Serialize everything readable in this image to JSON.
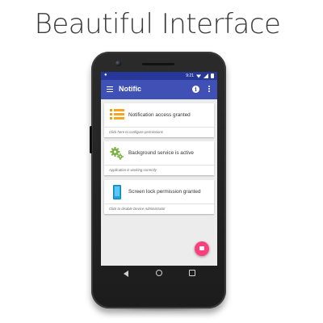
{
  "headline": "Beautiful Interface",
  "status_bar": {
    "time": "9:21",
    "notif_icon": "notification-icon"
  },
  "app_bar": {
    "title": "Notific",
    "menu_icon": "menu-icon",
    "info_icon": "info-icon",
    "overflow_icon": "overflow-menu-icon",
    "info_glyph": "i"
  },
  "cards": [
    {
      "title": "Notification access granted",
      "subtitle": "Click here to configure permissions",
      "icon": "list-icon"
    },
    {
      "title": "Background service is active",
      "subtitle": "Application is working correctly",
      "icon": "gears-icon"
    },
    {
      "title": "Screen lock permission granted",
      "subtitle": "Click to disable Device Administrator",
      "icon": "phone-icon"
    }
  ],
  "fab": {
    "icon": "feedback-icon"
  },
  "nav_bar": {
    "back": "back-icon",
    "home": "home-icon",
    "recents": "recents-icon"
  },
  "colors": {
    "app_bar": "#3f51b5",
    "status_bar": "#28389a",
    "fab": "#ff3f7c",
    "accent_orange": "#f5a623",
    "gear_green": "#7cb342",
    "phone_blue": "#1aa3e0"
  }
}
